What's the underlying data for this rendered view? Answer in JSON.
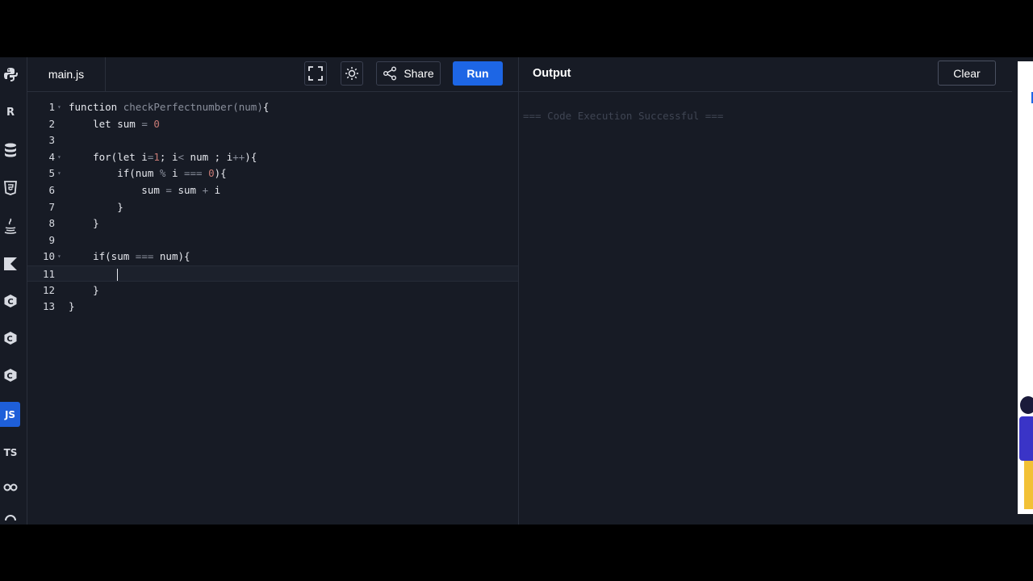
{
  "editor": {
    "file_tab": "main.js",
    "share_label": "Share",
    "run_label": "Run",
    "lines": [
      {
        "n": "1",
        "fold": "▾",
        "html": "<span class=\"kw\">function</span> <span class=\"fn\">checkPerfectnumber</span><span class=\"op\">(num)</span>{"
      },
      {
        "n": "2",
        "fold": "",
        "html": "    let sum <span class=\"op\">=</span> <span class=\"num\">0</span>"
      },
      {
        "n": "3",
        "fold": "",
        "html": ""
      },
      {
        "n": "4",
        "fold": "▾",
        "html": "    for(let i<span class=\"op\">=</span><span class=\"num\">1</span>; i<span class=\"op\">&lt;</span> num ; i<span class=\"op\">++</span>){"
      },
      {
        "n": "5",
        "fold": "▾",
        "html": "        if(num <span class=\"op\">%</span> i <span class=\"op\">===</span> <span class=\"num\">0</span>){"
      },
      {
        "n": "6",
        "fold": "",
        "html": "            sum <span class=\"op\">=</span> sum <span class=\"op\">+</span> i"
      },
      {
        "n": "7",
        "fold": "",
        "html": "        }"
      },
      {
        "n": "8",
        "fold": "",
        "html": "    }"
      },
      {
        "n": "9",
        "fold": "",
        "html": ""
      },
      {
        "n": "10",
        "fold": "▾",
        "html": "    if(sum <span class=\"op\">===</span> num){"
      },
      {
        "n": "11",
        "fold": "",
        "html": "        <span class=\"cursor\"></span>",
        "current": true
      },
      {
        "n": "12",
        "fold": "",
        "html": "    }"
      },
      {
        "n": "13",
        "fold": "",
        "html": "}"
      }
    ]
  },
  "output": {
    "title": "Output",
    "clear_label": "Clear",
    "text": "=== Code Execution Successful ==="
  },
  "rail": {
    "items": [
      {
        "name": "python-icon",
        "label": ""
      },
      {
        "name": "r-icon",
        "label": "R"
      },
      {
        "name": "sql-icon",
        "label": ""
      },
      {
        "name": "html-icon",
        "label": ""
      },
      {
        "name": "java-icon",
        "label": ""
      },
      {
        "name": "kotlin-icon",
        "label": ""
      },
      {
        "name": "c-icon",
        "label": ""
      },
      {
        "name": "cpp-icon",
        "label": ""
      },
      {
        "name": "csharp-icon",
        "label": ""
      },
      {
        "name": "js-icon",
        "label": "JS",
        "active": true
      },
      {
        "name": "ts-icon",
        "label": "TS"
      },
      {
        "name": "go-icon",
        "label": "GO"
      },
      {
        "name": "more-icon",
        "label": ""
      }
    ]
  }
}
